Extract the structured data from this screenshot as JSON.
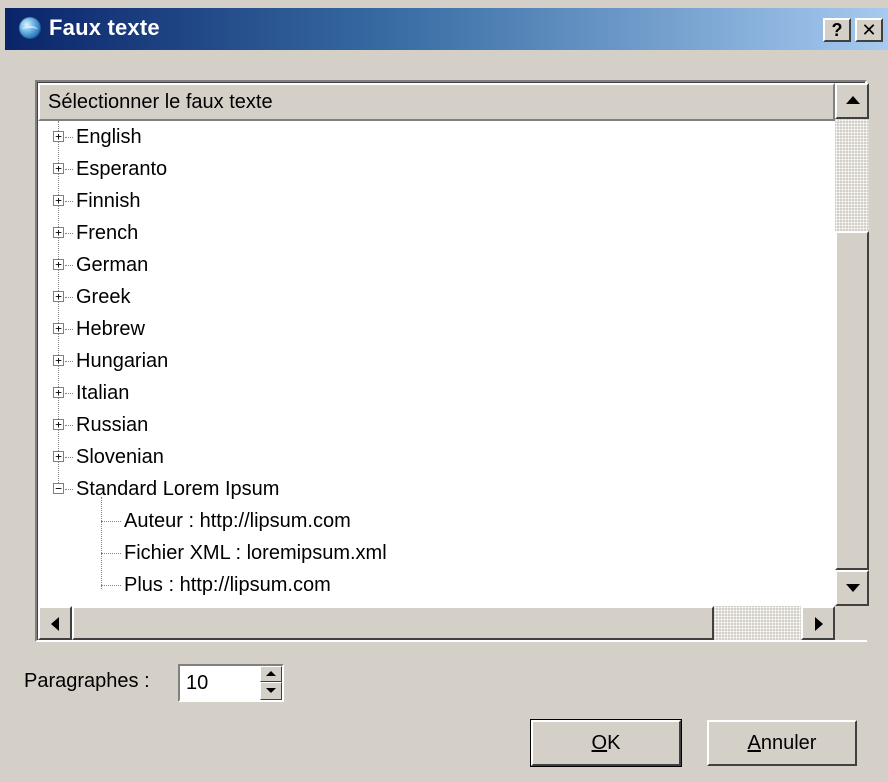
{
  "window": {
    "title": "Faux texte",
    "help_label": "?",
    "close_label": "✕"
  },
  "tree": {
    "header": "Sélectionner le faux texte",
    "items": [
      {
        "label": "English",
        "expander": "+"
      },
      {
        "label": "Esperanto",
        "expander": "+"
      },
      {
        "label": "Finnish",
        "expander": "+"
      },
      {
        "label": "French",
        "expander": "+"
      },
      {
        "label": "German",
        "expander": "+"
      },
      {
        "label": "Greek",
        "expander": "+"
      },
      {
        "label": "Hebrew",
        "expander": "+"
      },
      {
        "label": "Hungarian",
        "expander": "+"
      },
      {
        "label": "Italian",
        "expander": "+"
      },
      {
        "label": "Russian",
        "expander": "+"
      },
      {
        "label": "Slovenian",
        "expander": "+"
      },
      {
        "label": "Standard Lorem Ipsum",
        "expander": "−"
      }
    ],
    "children": [
      {
        "label": "Auteur : http://lipsum.com"
      },
      {
        "label": "Fichier XML : loremipsum.xml"
      },
      {
        "label": "Plus : http://lipsum.com"
      }
    ]
  },
  "paragraphs": {
    "label": "Paragraphes :",
    "value": "10"
  },
  "buttons": {
    "ok_mnemonic": "O",
    "ok_rest": "K",
    "cancel_mnemonic": "A",
    "cancel_rest": "nnuler"
  },
  "colors": {
    "title_start": "#0a246a",
    "title_end": "#a6caf0",
    "face": "#d4d0c8"
  },
  "icons": {
    "app": "globe-icon",
    "expand": "plus-box-icon",
    "collapse": "minus-box-icon"
  }
}
